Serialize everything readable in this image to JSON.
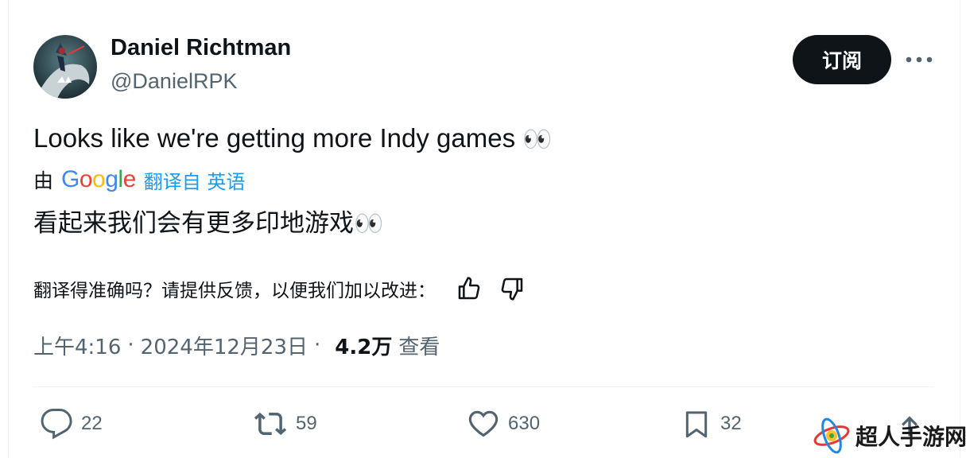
{
  "author": {
    "display_name": "Daniel Richtman",
    "handle": "@DanielRPK"
  },
  "header": {
    "subscribe_label": "订阅",
    "more_icon": "more-horizontal-icon"
  },
  "tweet": {
    "text": "Looks like we're getting more Indy games",
    "emoji": "👀",
    "translation": {
      "by_label": "由",
      "google_logo": [
        "G",
        "o",
        "o",
        "g",
        "l",
        "e"
      ],
      "google_colors": [
        "#4285F4",
        "#EA4335",
        "#FBBC05",
        "#4285F4",
        "#34A853",
        "#EA4335"
      ],
      "from_label": "翻译自 英语",
      "text": "看起来我们会有更多印地游戏",
      "emoji": "👀"
    },
    "feedback": {
      "prompt": "翻译得准确吗？请提供反馈，以便我们加以改进：",
      "like_icon": "thumbs-up-icon",
      "dislike_icon": "thumbs-down-icon"
    }
  },
  "meta": {
    "time": "上午4:16",
    "separator": "·",
    "date": "2024年12月23日",
    "views_count": "4.2万",
    "views_label": "查看"
  },
  "actions": {
    "replies": "22",
    "reposts": "59",
    "likes": "630",
    "bookmarks": "32"
  },
  "watermark": {
    "text": "超人手游网"
  },
  "colors": {
    "text_primary": "#0f1419",
    "text_secondary": "#536471",
    "link": "#1d9bf0",
    "button_bg": "#0f1419"
  }
}
